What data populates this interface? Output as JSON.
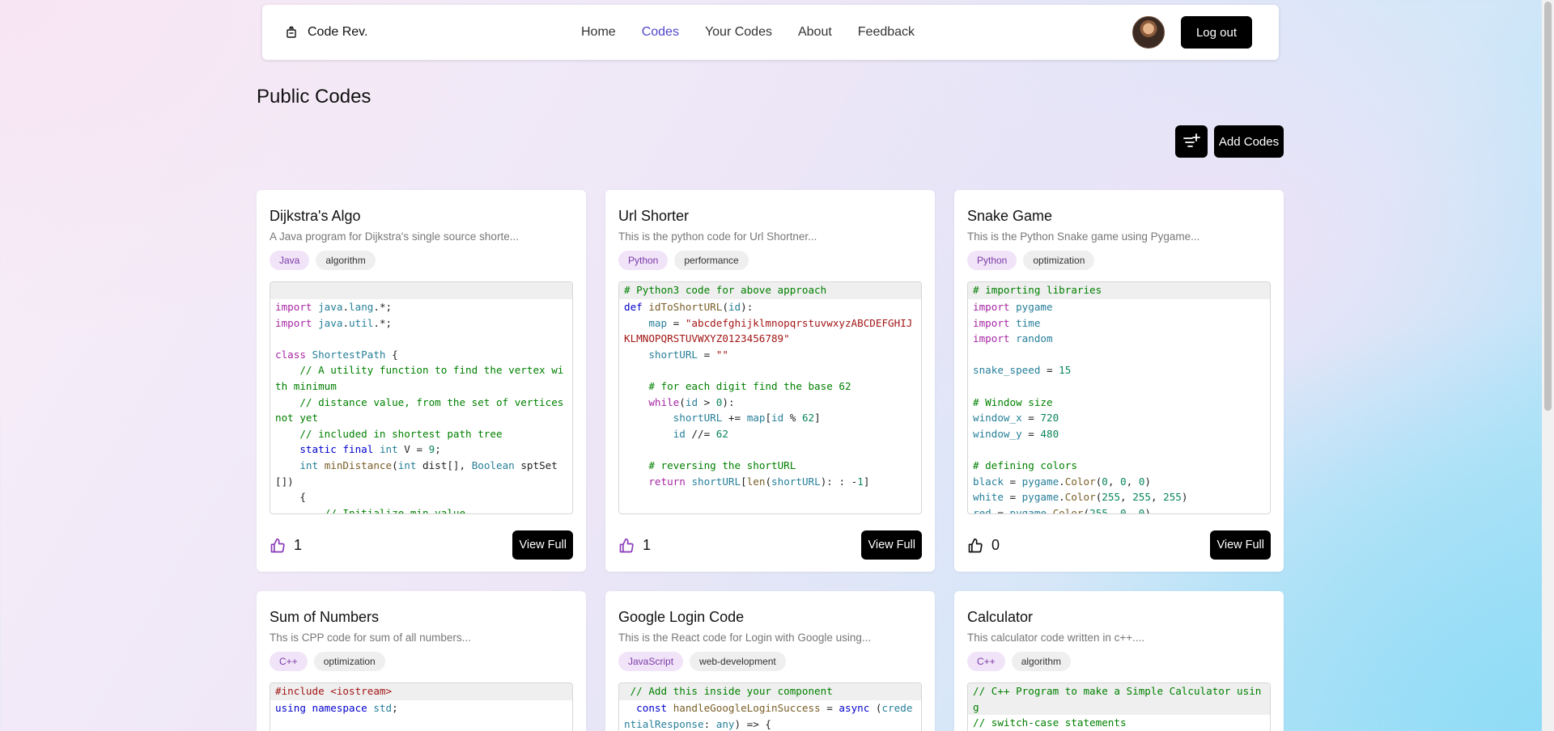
{
  "nav": {
    "brand": "Code Rev.",
    "links": [
      "Home",
      "Codes",
      "Your Codes",
      "About",
      "Feedback"
    ],
    "logout": "Log out"
  },
  "page": {
    "title": "Public Codes",
    "add_button": "Add Codes"
  },
  "view_full_label": "View Full",
  "cards": [
    {
      "title": "Dijkstra's Algo",
      "desc": "A Java program for Dijkstra's single source shorte...",
      "lang": "Java",
      "topic": "algorithm",
      "likes": "1"
    },
    {
      "title": "Url Shorter",
      "desc": "This is the python code for Url Shortner...",
      "lang": "Python",
      "topic": "performance",
      "likes": "1"
    },
    {
      "title": "Snake Game",
      "desc": "This is the Python Snake game using Pygame...",
      "lang": "Python",
      "topic": "optimization",
      "likes": "0"
    },
    {
      "title": "Sum of Numbers",
      "desc": "Ths is CPP code for sum of all numbers...",
      "lang": "C++",
      "topic": "optimization"
    },
    {
      "title": "Google Login Code",
      "desc": "This is the React code for Login with Google using...",
      "lang": "JavaScript",
      "topic": "web-development"
    },
    {
      "title": "Calculator",
      "desc": "This calculator code written in c++....",
      "lang": "C++",
      "topic": "algorithm"
    }
  ],
  "colors": {
    "active_link": "#4f46c8",
    "lang_tag_bg": "#f1e4f8",
    "lang_tag_text": "#7b3aa6",
    "button_bg": "#000000"
  }
}
